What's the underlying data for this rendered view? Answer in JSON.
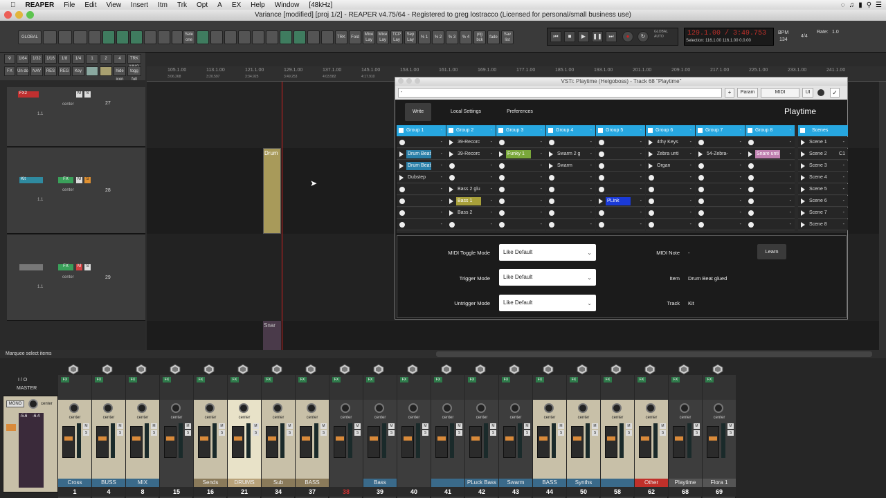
{
  "menubar": {
    "apple": "",
    "app": "REAPER",
    "items": [
      "File",
      "Edit",
      "View",
      "Insert",
      "Itm",
      "Trk",
      "Opt",
      "A",
      "EX",
      "Help",
      "Window",
      "[48kHz]"
    ]
  },
  "window": {
    "title": "Variance [modified] [proj 1/2] - REAPER v4.75/64 - Registered to greg lostracco (Licensed for personal/small business use)"
  },
  "toolbar": {
    "global": "GLOBAL",
    "buttons": [
      "Sele one",
      "TRK",
      "Fold",
      "Mixe Lay",
      "Mixe Lay",
      "TCP Lay",
      "Sep Lay",
      "% 1",
      "% 2",
      "% 3",
      "% 4",
      "plg bck",
      "fade",
      "Sav list"
    ],
    "global_auto": "GLOBAL AUTO",
    "time_main": "129.1.00 / 3:49.753",
    "selection": "Selection: 116.1.00  116.1.00  0.0.00",
    "bpm_label": "BPM",
    "bpm": "134",
    "sig": "4/4",
    "rate_label": "Rate:",
    "rate": "1.0"
  },
  "grid": {
    "row1": [
      "1/64",
      "1/32",
      "1/16",
      "1/8",
      "1/4",
      "1",
      "2",
      "4",
      "TRK MNG"
    ],
    "row2": [
      "FX",
      "Un do",
      "NAV",
      "RES",
      "REG",
      "Key",
      "",
      "",
      "hide icon",
      "togg full"
    ]
  },
  "ruler": {
    "ticks": [
      "105.1.00",
      "113.1.00",
      "121.1.00",
      "129.1.00",
      "137.1.00",
      "145.1.00",
      "153.1.00",
      "161.1.00",
      "169.1.00",
      "177.1.00",
      "185.1.00",
      "193.1.00",
      "201.1.00",
      "209.1.00",
      "217.1.00",
      "225.1.00",
      "233.1.00",
      "241.1.00"
    ],
    "sub": [
      "3:06.268",
      "3:20.597",
      "3:34.925",
      "3:49.253",
      "4:03.582",
      "4:17.910"
    ]
  },
  "tracks": [
    {
      "name": "FX2",
      "pan": "center",
      "vol": "1.1",
      "num": "27"
    },
    {
      "name": "Kit",
      "pan": "center",
      "vol": "1.1",
      "num": "28"
    },
    {
      "name": "",
      "pan": "center",
      "vol": "1.1",
      "num": "29"
    }
  ],
  "items": {
    "drum": "Drum",
    "snare": "Snar"
  },
  "playtime": {
    "title": "VSTi: Playtime (Helgoboss) - Track 68 \"Playtime\"",
    "toolbar": {
      "preset": "-",
      "plus": "+",
      "param": "Param",
      "midi": "MIDI",
      "ui": "UI"
    },
    "tabs": [
      "Write",
      "Local Settings",
      "Preferences"
    ],
    "brand": "Playtime",
    "groups": [
      "Group 1",
      "Group 2",
      "Group 3",
      "Group 4",
      "Group 5",
      "Group 6",
      "Group 7",
      "Group 8"
    ],
    "scenes_header": "Scenes",
    "scenes": [
      "Scene 1",
      "Scene 2",
      "Scene 3",
      "Scene 4",
      "Scene 5",
      "Scene 6",
      "Scene 7",
      "Scene 8"
    ],
    "scene2_tag": "C1",
    "cells": {
      "r0": [
        "",
        "39-Recorc",
        "",
        "",
        "",
        "4thy Keys",
        "",
        ""
      ],
      "r1": [
        "Drum Beat",
        "39-Recorc",
        "Funky 1",
        "Swarm 2 g",
        "",
        "Zebra unti",
        "54-Zebra-",
        "Snare unti"
      ],
      "r2": [
        "Drum Beat",
        "",
        "",
        "Swarm",
        "",
        "Organ",
        "",
        ""
      ],
      "r3": [
        "Dubstep",
        "",
        "",
        "",
        "",
        "",
        "",
        ""
      ],
      "r4": [
        "",
        "Bass 2 glu",
        "",
        "",
        "",
        "",
        "",
        ""
      ],
      "r5": [
        "",
        "Bass 1",
        "",
        "",
        "PLink",
        "",
        "",
        ""
      ],
      "r6": [
        "",
        "Bass 2",
        "",
        "",
        "",
        "",
        "",
        ""
      ],
      "r7": [
        "",
        "",
        "",
        "",
        "",
        "",
        "",
        ""
      ]
    },
    "form": {
      "midi_toggle_label": "MIDI Toggle Mode",
      "midi_toggle_value": "Like Default",
      "trigger_label": "Trigger Mode",
      "trigger_value": "Like Default",
      "untrigger_label": "Untrigger Mode",
      "untrigger_value": "Like Default",
      "midi_note_label": "MIDI Note",
      "midi_note_value": "-",
      "learn": "Learn",
      "item_label": "Item",
      "item_value": "Drum Beat glued",
      "track_label": "Track",
      "track_value": "Kit"
    }
  },
  "status": {
    "text": "Marquee select items"
  },
  "mixer": {
    "master_label": "MASTER",
    "mono": "MONO",
    "center": "center",
    "io": "I / O",
    "master_peaks": [
      "-5.6",
      "-6.4"
    ],
    "strips": [
      {
        "name": "Cross",
        "num": "1",
        "color": "#3a6a8a"
      },
      {
        "name": "BUSS",
        "num": "4",
        "color": "#3a6a8a"
      },
      {
        "name": "MIX",
        "num": "8",
        "color": "#3a6a8a"
      },
      {
        "name": "",
        "num": "15",
        "color": "#3d3d3d"
      },
      {
        "name": "Sends",
        "num": "16",
        "color": "#8a7a5a"
      },
      {
        "name": "DRUMS",
        "num": "21",
        "color": "#b8a27a"
      },
      {
        "name": "Sub",
        "num": "34",
        "color": "#8a7a5a"
      },
      {
        "name": "BASS",
        "num": "37",
        "color": "#8a7a5a"
      },
      {
        "name": "",
        "num": "38",
        "color": "#3d3d3d"
      },
      {
        "name": "Bass",
        "num": "39",
        "color": "#3a6a8a"
      },
      {
        "name": "",
        "num": "40",
        "color": "#3d3d3d"
      },
      {
        "name": "",
        "num": "41",
        "color": "#3a6a8a"
      },
      {
        "name": "PLuck Bass",
        "num": "42",
        "color": "#3a6a8a"
      },
      {
        "name": "Swarm",
        "num": "43",
        "color": "#3a6a8a"
      },
      {
        "name": "BASS",
        "num": "44",
        "color": "#3a6a8a"
      },
      {
        "name": "Synths",
        "num": "50",
        "color": "#3a6a8a"
      },
      {
        "name": "",
        "num": "58",
        "color": "#3a6a8a"
      },
      {
        "name": "Other",
        "num": "62",
        "color": "#c0302a"
      },
      {
        "name": "Playtime",
        "num": "68",
        "color": "#555"
      },
      {
        "name": "Flora 1",
        "num": "69",
        "color": "#555"
      }
    ]
  },
  "colors": {
    "accent": "#27a7e0",
    "record": "#d02020",
    "item_gold": "#a89a5a"
  }
}
